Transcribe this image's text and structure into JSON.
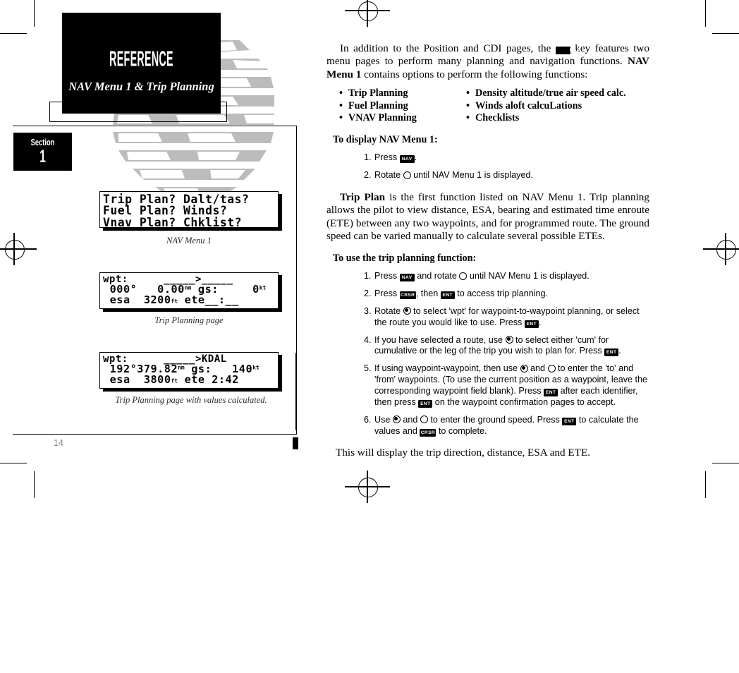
{
  "header": {
    "title": "REFERENCE",
    "subtitle": "NAV Menu 1 & Trip Planning",
    "section_word": "Section",
    "section_number": "1"
  },
  "page": {
    "number": "14"
  },
  "screens": [
    {
      "name": "nav-menu-1",
      "caption": "NAV Menu 1",
      "lines": [
        "Trip Plan? Dalt/tas?",
        "Fuel Plan? Winds?",
        "Vnav Plan? Chklist?"
      ]
    },
    {
      "name": "trip-planning-blank",
      "caption": "Trip Planning page",
      "line1_label": "wpt:",
      "line1_value": "_____>_____",
      "line2_bearing": "000°",
      "line2_distance": "0.00",
      "line2_distance_unit": "nm",
      "line2_gs_label": "gs:",
      "line2_gs_value": "0",
      "line2_gs_unit": "kt",
      "line3_esa_label": "esa",
      "line3_esa_value": "3200",
      "line3_esa_unit": "ft",
      "line3_ete_label": "ete",
      "line3_ete_value": "__:__"
    },
    {
      "name": "trip-planning-calculated",
      "caption": "Trip Planning page with values calculated.",
      "line1_label": "wpt:",
      "line1_value": "_____>KDAL",
      "line2_bearing": "192°",
      "line2_distance": "379.82",
      "line2_distance_unit": "nm",
      "line2_gs_label": "gs:",
      "line2_gs_value": "140",
      "line2_gs_unit": "kt",
      "line3_esa_label": "esa",
      "line3_esa_value": "3800",
      "line3_esa_unit": "ft",
      "line3_ete_label": "ete",
      "line3_ete_value": "2:42"
    }
  ],
  "content": {
    "intro_a": "In addition to the Position and CDI pages, the ",
    "intro_key": "NAV",
    "intro_b": " key features two menu pages to perform many planning and navigation functions. ",
    "intro_bold": "NAV Menu 1",
    "intro_c": " contains options to perform the following functions:",
    "bullets_left": [
      "Trip Planning",
      "Fuel Planning",
      "VNAV Planning"
    ],
    "bullets_right": [
      "Density altitude/true air speed calc.",
      "Winds aloft calcuLations",
      "Checklists"
    ],
    "bullet_marker": "•",
    "proc1_head": "To display NAV Menu 1:",
    "proc1_steps": [
      {
        "num": "1.",
        "a": "Press ",
        "key1": "NAV",
        "b": "."
      },
      {
        "num": "2.",
        "a": "Rotate ",
        "knob": "outer",
        "b": " until NAV Menu 1 is displayed."
      }
    ],
    "tripplan_bold": "Trip Plan",
    "tripplan_body": " is the first function listed on NAV Menu 1. Trip planning allows the pilot to view distance, ESA, bearing and estimated time enroute (ETE) between any two waypoints, and for programmed route. The ground speed can be varied manually to calculate several possible ETEs.",
    "proc2_head": "To use the trip planning function:",
    "proc2_steps": [
      {
        "num": "1.",
        "a": "Press ",
        "key1": "NAV",
        "b": " and rotate ",
        "knob1": "outer",
        "c": " until NAV Menu 1 is displayed."
      },
      {
        "num": "2.",
        "a": "Press ",
        "key1": "CRSR",
        "b": ", then ",
        "key2": "ENT",
        "c": " to access trip planning."
      },
      {
        "num": "3.",
        "a": "Rotate ",
        "knob1": "inner",
        "b": " to select 'wpt' for waypoint-to-waypoint planning, or select the route you would like to use. Press ",
        "key1": "ENT",
        "c": "."
      },
      {
        "num": "4.",
        "a": "If you have selected a route, use ",
        "knob1": "inner",
        "b": " to select either 'cum' for cumulative or the leg of the trip you wish to plan for. Press ",
        "key1": "ENT",
        "c": "."
      },
      {
        "num": "5.",
        "a": "If using waypoint-waypoint, then use ",
        "knob1": "inner",
        "b": " and ",
        "knob2": "outer",
        "c": " to enter the 'to' and 'from' waypoints. (To use the current position as a waypoint, leave the corresponding waypoint field blank). Press ",
        "key1": "ENT",
        "d": " after each identifier, then press ",
        "key2": "ENT",
        "e": " on the waypoint confirmation pages to accept."
      },
      {
        "num": "6.",
        "a": "Use ",
        "knob1": "inner",
        "b": " and ",
        "knob2": "outer",
        "c": " to enter the ground speed. Press ",
        "key1": "ENT",
        "d": " to calculate the values and ",
        "key2": "CRSR",
        "e": " to complete."
      }
    ],
    "closing": "This will display the trip direction, distance, ESA and ETE."
  }
}
